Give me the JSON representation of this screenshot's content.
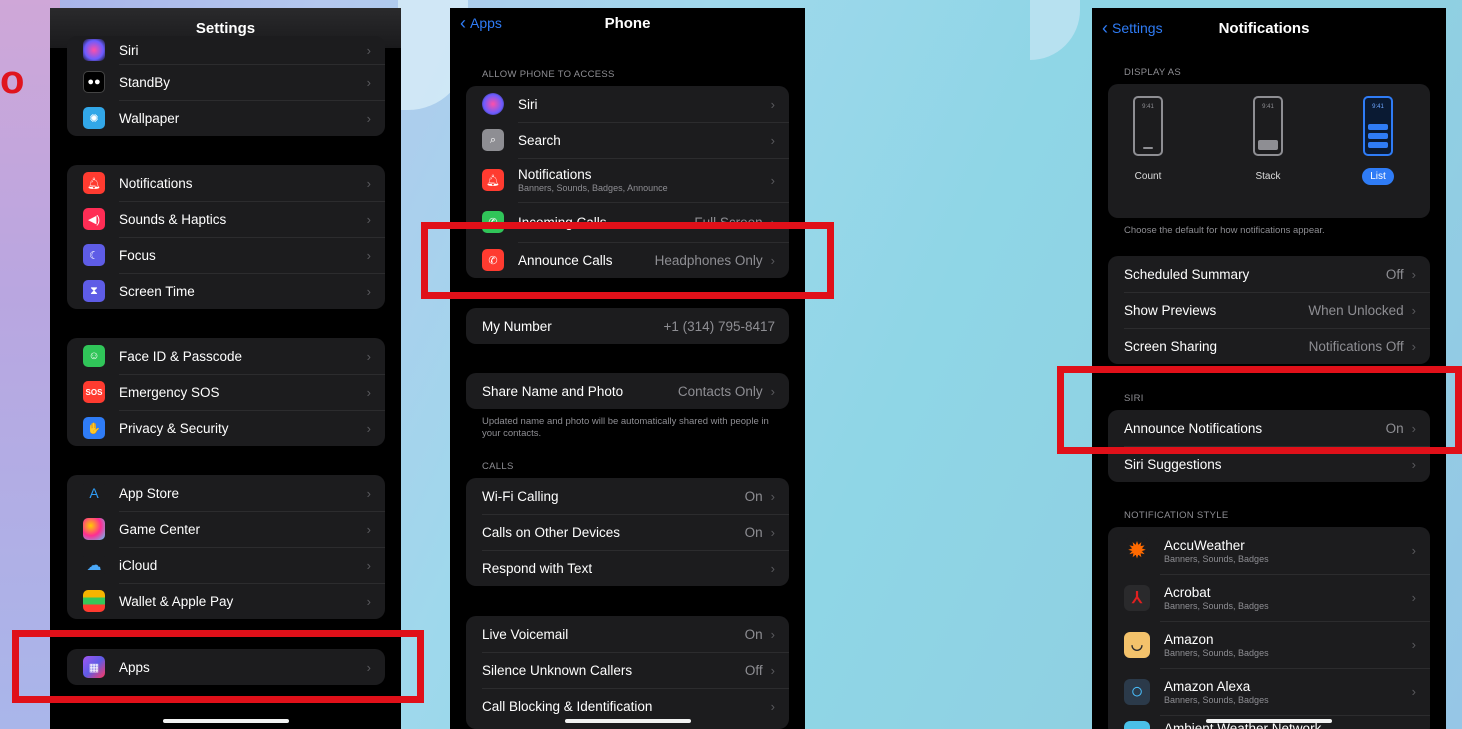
{
  "left_partial_letter": "o",
  "settings": {
    "title": "Settings",
    "group1": [
      {
        "label": "Siri",
        "icon": "siri-icon"
      },
      {
        "label": "StandBy",
        "icon": "standby-icon"
      },
      {
        "label": "Wallpaper",
        "icon": "wallpaper-icon"
      }
    ],
    "group2": [
      {
        "label": "Notifications",
        "icon": "notifications-icon"
      },
      {
        "label": "Sounds & Haptics",
        "icon": "sounds-icon"
      },
      {
        "label": "Focus",
        "icon": "focus-icon"
      },
      {
        "label": "Screen Time",
        "icon": "screen-time-icon"
      }
    ],
    "group3": [
      {
        "label": "Face ID & Passcode",
        "icon": "faceid-icon"
      },
      {
        "label": "Emergency SOS",
        "icon_text": "SOS",
        "icon": "sos-icon"
      },
      {
        "label": "Privacy & Security",
        "icon": "privacy-icon"
      }
    ],
    "group4": [
      {
        "label": "App Store",
        "icon": "app-store-icon"
      },
      {
        "label": "Game Center",
        "icon": "game-center-icon"
      },
      {
        "label": "iCloud",
        "icon": "icloud-icon"
      },
      {
        "label": "Wallet & Apple Pay",
        "icon": "wallet-icon"
      }
    ],
    "group5": [
      {
        "label": "Apps",
        "icon": "apps-icon"
      }
    ]
  },
  "phone": {
    "back": "Apps",
    "title": "Phone",
    "access_header": "ALLOW PHONE TO ACCESS",
    "access": [
      {
        "label": "Siri"
      },
      {
        "label": "Search"
      },
      {
        "label": "Notifications",
        "sub": "Banners, Sounds, Badges, Announce"
      },
      {
        "label": "Incoming Calls",
        "value": "Full Screen"
      },
      {
        "label": "Announce Calls",
        "value": "Headphones Only"
      }
    ],
    "my_number": {
      "label": "My Number",
      "value": "+1 (314) 795-8417"
    },
    "share": {
      "label": "Share Name and Photo",
      "value": "Contacts Only"
    },
    "share_footer": "Updated name and photo will be automatically shared with people in your contacts.",
    "calls_header": "CALLS",
    "calls": [
      {
        "label": "Wi-Fi Calling",
        "value": "On"
      },
      {
        "label": "Calls on Other Devices",
        "value": "On"
      },
      {
        "label": "Respond with Text",
        "value": ""
      }
    ],
    "voicemail": [
      {
        "label": "Live Voicemail",
        "value": "On"
      },
      {
        "label": "Silence Unknown Callers",
        "value": "Off"
      },
      {
        "label": "Call Blocking & Identification",
        "value": ""
      }
    ]
  },
  "notifications": {
    "back": "Settings",
    "title": "Notifications",
    "display_header": "DISPLAY AS",
    "options": [
      {
        "label": "Count",
        "time": "9:41"
      },
      {
        "label": "Stack",
        "time": "9:41"
      },
      {
        "label": "List",
        "time": "9:41",
        "selected": true
      }
    ],
    "display_footer": "Choose the default for how notifications appear.",
    "settings": [
      {
        "label": "Scheduled Summary",
        "value": "Off"
      },
      {
        "label": "Show Previews",
        "value": "When Unlocked"
      },
      {
        "label": "Screen Sharing",
        "value": "Notifications Off"
      }
    ],
    "siri_header": "SIRI",
    "siri": [
      {
        "label": "Announce Notifications",
        "value": "On"
      },
      {
        "label": "Siri Suggestions",
        "value": ""
      }
    ],
    "style_header": "NOTIFICATION STYLE",
    "apps": [
      {
        "label": "AccuWeather",
        "sub": "Banners, Sounds, Badges"
      },
      {
        "label": "Acrobat",
        "sub": "Banners, Sounds, Badges"
      },
      {
        "label": "Amazon",
        "sub": "Banners, Sounds, Badges"
      },
      {
        "label": "Amazon Alexa",
        "sub": "Banners, Sounds, Badges"
      },
      {
        "label": "Ambient Weather Network",
        "sub": ""
      }
    ]
  },
  "colors": {
    "highlight": "#e01019",
    "accent": "#2f7cf6",
    "row_bg": "#1c1c1e"
  }
}
